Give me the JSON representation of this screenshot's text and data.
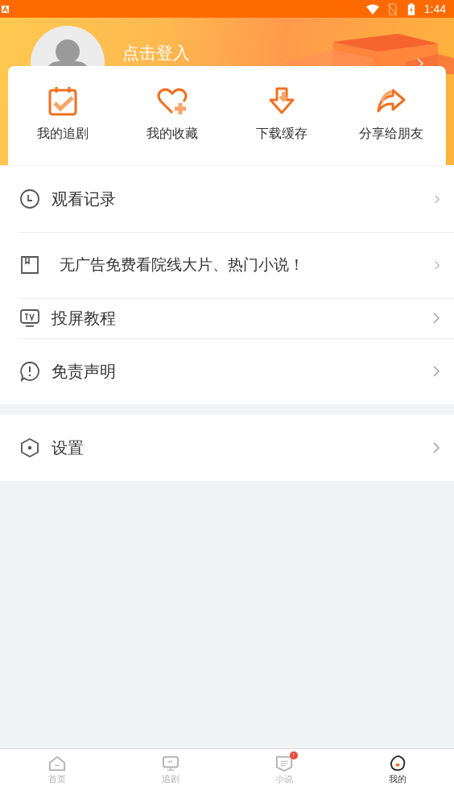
{
  "status_bar": {
    "time": "1:44"
  },
  "profile": {
    "login_label": "点击登入"
  },
  "shortcuts": [
    {
      "label": "我的追剧"
    },
    {
      "label": "我的收藏"
    },
    {
      "label": "下载缓存"
    },
    {
      "label": "分享给朋友"
    }
  ],
  "menu_groups": [
    {
      "items": [
        {
          "label": "观看记录"
        },
        {
          "label": "无广告免费看院线大片、热门小说！"
        },
        {
          "label": "投屏教程"
        },
        {
          "label": "免责声明"
        }
      ]
    },
    {
      "items": [
        {
          "label": "设置"
        }
      ]
    }
  ],
  "tab_bar": [
    {
      "label": "首页",
      "selected": false
    },
    {
      "label": "追剧",
      "selected": false
    },
    {
      "label": "小说",
      "selected": false,
      "badge": "!"
    },
    {
      "label": "我的",
      "selected": true
    }
  ]
}
